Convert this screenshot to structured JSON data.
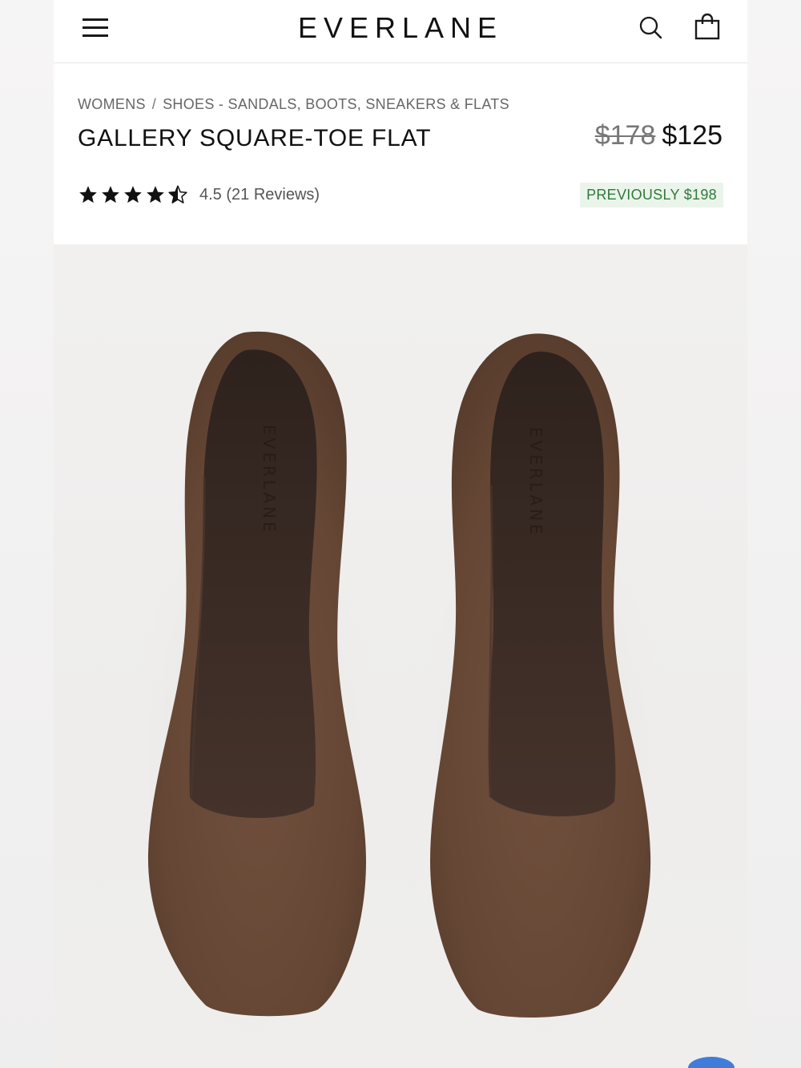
{
  "header": {
    "brand": "EVERLANE",
    "menu_icon": "hamburger-menu-icon",
    "search_icon": "search-icon",
    "bag_icon": "shopping-bag-icon"
  },
  "breadcrumb": {
    "items": [
      "WOMENS",
      "SHOES - SANDALS, BOOTS, SNEAKERS & FLATS"
    ],
    "separator": "/"
  },
  "product": {
    "title": "GALLERY SQUARE-TOE FLAT",
    "original_price": "$178",
    "sale_price": "$125",
    "rating_value": 4.5,
    "rating_max": 5,
    "rating_text": "4.5 (21 Reviews)",
    "badge": "PREVIOUSLY $198",
    "insole_brand": "EVERLANE"
  },
  "colors": {
    "badge_bg": "#eaf4ea",
    "badge_text": "#2f7a3a",
    "shoe_suede": "#6a4836",
    "insole": "#3d2c25"
  }
}
